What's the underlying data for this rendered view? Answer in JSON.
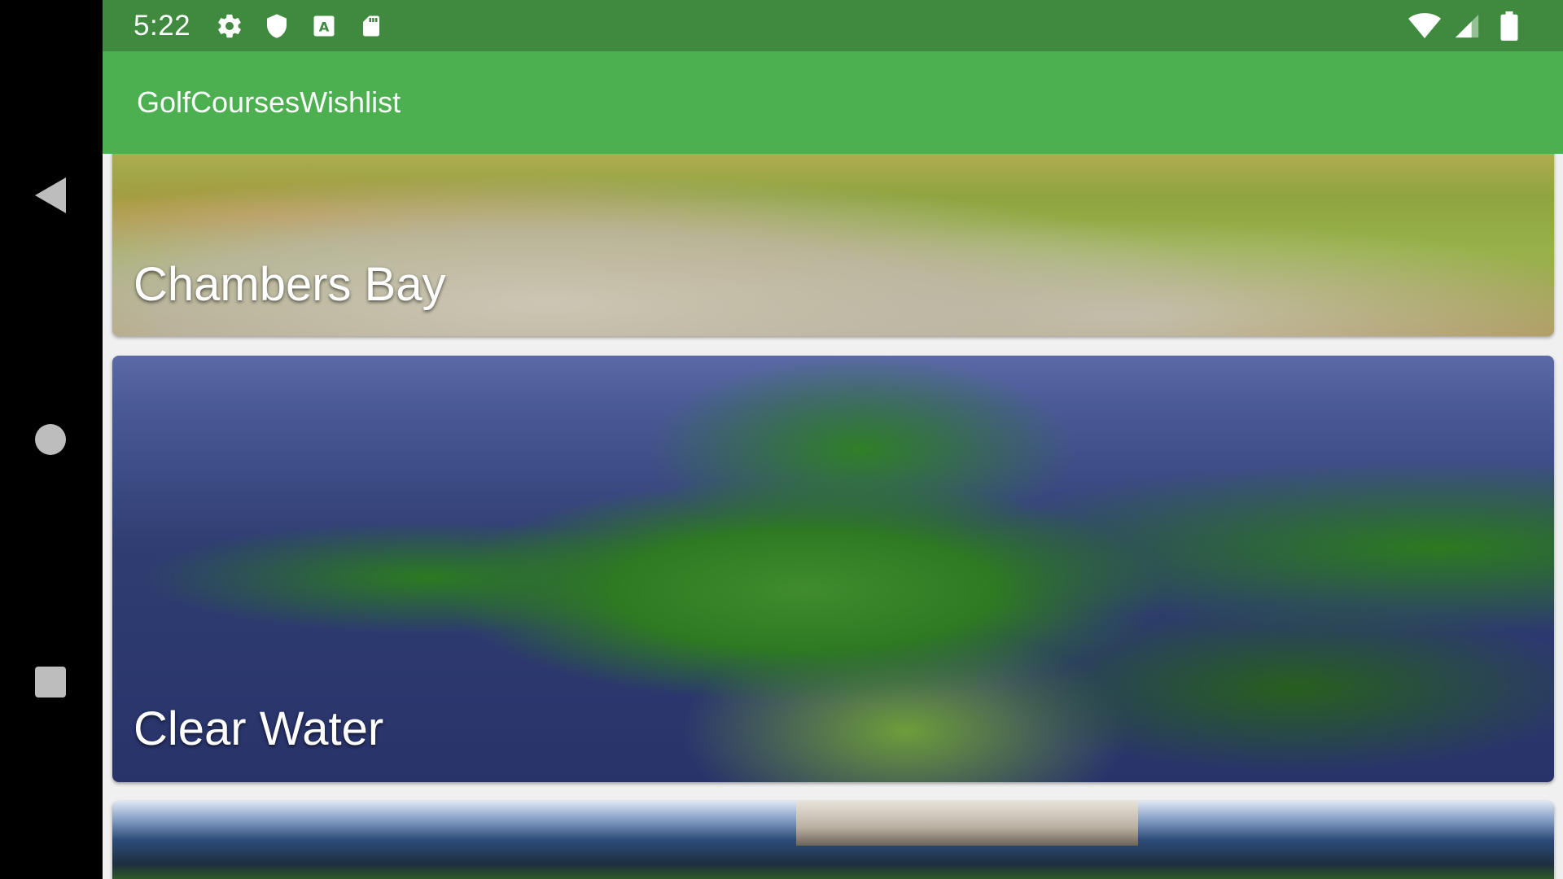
{
  "statusbar": {
    "time": "5:22",
    "left_icons": [
      "gear-icon",
      "shield-icon",
      "keyboard-a-icon",
      "sd-card-icon"
    ],
    "right_icons": [
      "wifi-icon",
      "cell-signal-icon",
      "battery-icon"
    ],
    "color": "#3f8a3f"
  },
  "appbar": {
    "title": "GolfCoursesWishlist",
    "color": "#4caf50"
  },
  "navigation": {
    "buttons": [
      "back-icon",
      "home-icon",
      "recents-icon"
    ]
  },
  "courses": [
    {
      "name": "Chambers Bay"
    },
    {
      "name": "Clear Water"
    },
    {
      "name": ""
    }
  ]
}
